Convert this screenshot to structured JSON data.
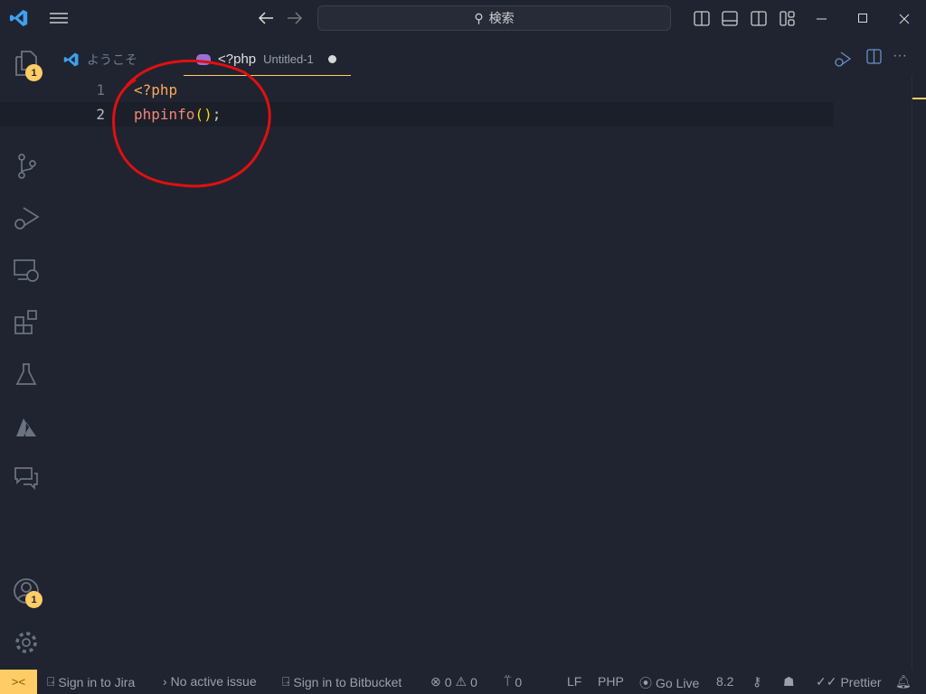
{
  "titlebar": {
    "search_placeholder": "検索",
    "icons": [
      "vscode-logo",
      "menu-icon",
      "back-arrow-icon",
      "forward-arrow-icon",
      "search-icon",
      "toggle-primary-sidebar-icon",
      "toggle-panel-icon",
      "toggle-secondary-sidebar-icon",
      "customize-layout-icon",
      "minimize-icon",
      "maximize-icon",
      "close-icon"
    ]
  },
  "activity_bar": {
    "explorer_badge": "1",
    "accounts_badge": "1"
  },
  "tabs": [
    {
      "label": "ようこそ"
    },
    {
      "label": "<?php",
      "description": "Untitled-1",
      "modified": true
    }
  ],
  "editor": {
    "lines": [
      {
        "number": "1",
        "text": "<?php"
      },
      {
        "number": "2",
        "func": "phpinfo",
        "paren_open": "(",
        "paren_close": ")",
        "semi": ";"
      }
    ]
  },
  "status": {
    "jira": "Sign in to Jira",
    "issue": "No active issue",
    "bitbucket": "Sign in to Bitbucket",
    "errors": "0",
    "warnings": "0",
    "ports": "0",
    "eol": "LF",
    "language": "PHP",
    "golive": "Go Live",
    "version": "8.2",
    "prettier": "Prettier"
  },
  "colors": {
    "background": "#1f2430",
    "accent": "#ffcc66",
    "annotation": "#e01010"
  }
}
